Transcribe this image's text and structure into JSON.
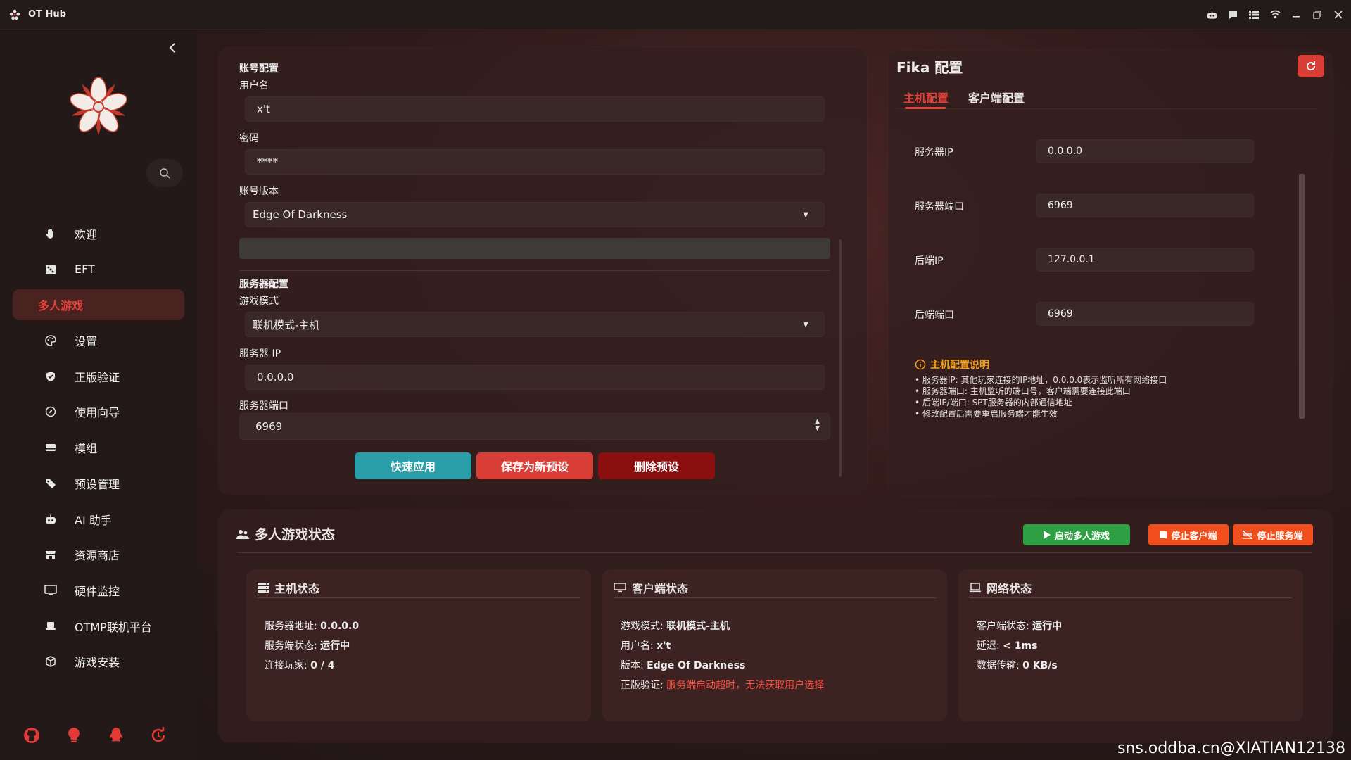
{
  "window": {
    "title": "OT Hub"
  },
  "sidebar": {
    "items": [
      {
        "label": "欢迎",
        "icon": "hand-icon"
      },
      {
        "label": "EFT",
        "icon": "dice-icon"
      },
      {
        "label": "多人游戏",
        "icon": "multiplayer-icon",
        "active": true
      },
      {
        "label": "设置",
        "icon": "palette-icon"
      },
      {
        "label": "正版验证",
        "icon": "shield-icon"
      },
      {
        "label": "使用向导",
        "icon": "compass-icon"
      },
      {
        "label": "模组",
        "icon": "card-icon"
      },
      {
        "label": "预设管理",
        "icon": "tag-icon"
      },
      {
        "label": "AI 助手",
        "icon": "robot-icon"
      },
      {
        "label": "资源商店",
        "icon": "store-icon"
      },
      {
        "label": "硬件监控",
        "icon": "monitor-icon"
      },
      {
        "label": "OTMP联机平台",
        "icon": "laptop-icon"
      },
      {
        "label": "游戏安装",
        "icon": "box-icon"
      }
    ]
  },
  "account": {
    "section_title": "账号配置",
    "username_label": "用户名",
    "username_value": "x't",
    "password_label": "密码",
    "password_value": "****",
    "version_label": "账号版本",
    "version_value": "Edge Of Darkness",
    "server_section_title": "服务器配置",
    "mode_label": "游戏模式",
    "mode_value": "联机模式-主机",
    "server_ip_label": "服务器 IP",
    "server_ip_value": "0.0.0.0",
    "server_port_label": "服务器端口",
    "server_port_value": "6969",
    "btn_apply": "快速应用",
    "btn_save": "保存为新预设",
    "btn_delete": "删除预设"
  },
  "fika": {
    "title": "Fika 配置",
    "tab_host": "主机配置",
    "tab_client": "客户端配置",
    "fields": [
      {
        "label": "服务器IP",
        "value": "0.0.0.0"
      },
      {
        "label": "服务器端口",
        "value": "6969"
      },
      {
        "label": "后端IP",
        "value": "127.0.0.1"
      },
      {
        "label": "后端端口",
        "value": "6969"
      }
    ],
    "note_title": "主机配置说明",
    "note_lines": [
      "• 服务器IP: 其他玩家连接的IP地址，0.0.0.0表示监听所有网络接口",
      "• 服务器端口: 主机监听的端口号，客户端需要连接此端口",
      "• 后端IP/端口: SPT服务器的内部通信地址",
      "• 修改配置后需要重启服务端才能生效"
    ]
  },
  "status": {
    "title": "多人游戏状态",
    "btn_start": "启动多人游戏",
    "btn_stop_client": "停止客户端",
    "btn_stop_server": "停止服务端",
    "host": {
      "title": "主机状态",
      "rows": [
        {
          "k": "服务器地址: ",
          "v": "0.0.0.0"
        },
        {
          "k": "服务端状态: ",
          "v": "运行中"
        },
        {
          "k": "连接玩家: ",
          "v": "0 / 4"
        }
      ]
    },
    "client": {
      "title": "客户端状态",
      "rows": [
        {
          "k": "游戏模式: ",
          "v": "联机模式-主机"
        },
        {
          "k": "用户名: ",
          "v": "x't"
        },
        {
          "k": "版本: ",
          "v": "Edge Of Darkness"
        },
        {
          "k": "正版验证: ",
          "v": "服务端启动超时，无法获取用户选择"
        }
      ]
    },
    "network": {
      "title": "网络状态",
      "rows": [
        {
          "k": "客户端状态: ",
          "v": "运行中"
        },
        {
          "k": "延迟: ",
          "v": "< 1ms"
        },
        {
          "k": "数据传输: ",
          "v": "0 KB/s"
        }
      ]
    }
  },
  "watermark": "sns.oddba.cn@XIATIAN12138",
  "colors": {
    "accent": "#e2423a",
    "teal": "#2a9ea6",
    "warn": "#f3a020"
  }
}
